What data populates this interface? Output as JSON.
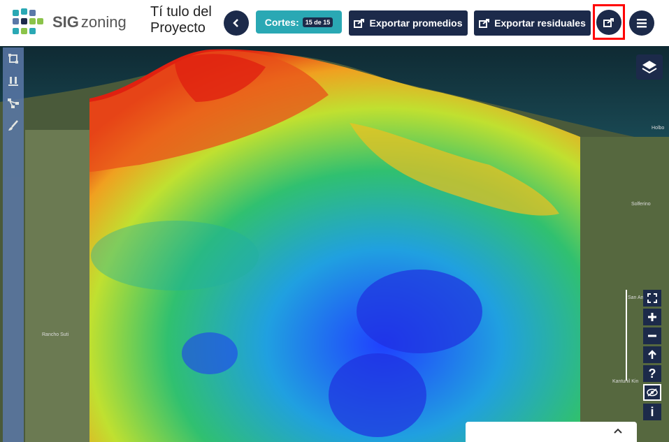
{
  "header": {
    "brand_bold": "SIG",
    "brand_rest": "zoning",
    "project_title": "Tí tulo del Proyecto",
    "cortes_label": "Cortes:",
    "cortes_badge": "15 de 15",
    "export_promedios": "Exportar promedios",
    "export_residuales": "Exportar residuales"
  },
  "map": {
    "labels": [
      "Holbo",
      "Solferino",
      "San An",
      "Kantunil Kin",
      "Rancho Suti"
    ]
  },
  "zoom_controls": {
    "help": "?",
    "info": "i"
  },
  "colors": {
    "navy": "#1c2a4a",
    "teal": "#2aa8b4",
    "highlight": "#ff0000"
  }
}
